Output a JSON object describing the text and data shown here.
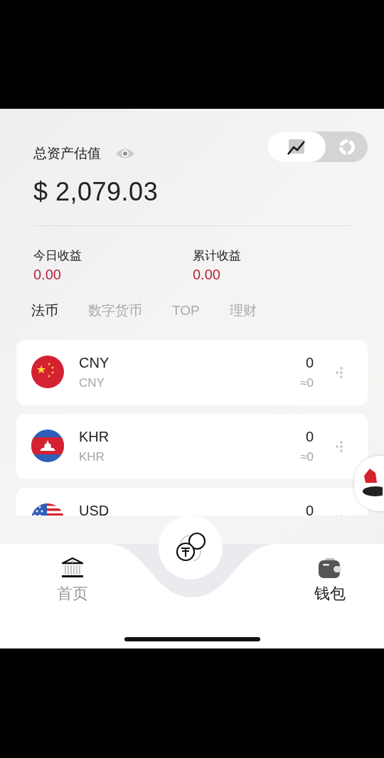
{
  "balance": {
    "title": "总资产估值",
    "amount": "$ 2,079.03"
  },
  "view_toggle": [
    {
      "kind": "line",
      "selected": true
    },
    {
      "kind": "donut",
      "selected": false
    }
  ],
  "earnings": [
    {
      "label": "今日收益",
      "value": "0.00"
    },
    {
      "label": "累计收益",
      "value": "0.00"
    }
  ],
  "tabs": [
    {
      "label": "法币",
      "selected": true
    },
    {
      "label": "数字货币",
      "selected": false
    },
    {
      "label": "TOP",
      "selected": false
    },
    {
      "label": "理财",
      "selected": false
    }
  ],
  "assets": [
    {
      "kind": "cn",
      "code": "CNY",
      "name": "CNY",
      "amount": "0",
      "approx": "≈0"
    },
    {
      "kind": "kh",
      "code": "KHR",
      "name": "KHR",
      "amount": "0",
      "approx": "≈0"
    },
    {
      "kind": "us",
      "code": "USD",
      "amount": "0"
    }
  ],
  "nav": [
    {
      "kind": "home",
      "label": "首页",
      "selected": false
    },
    {
      "kind": "wallet",
      "label": "钱包",
      "selected": true
    }
  ]
}
